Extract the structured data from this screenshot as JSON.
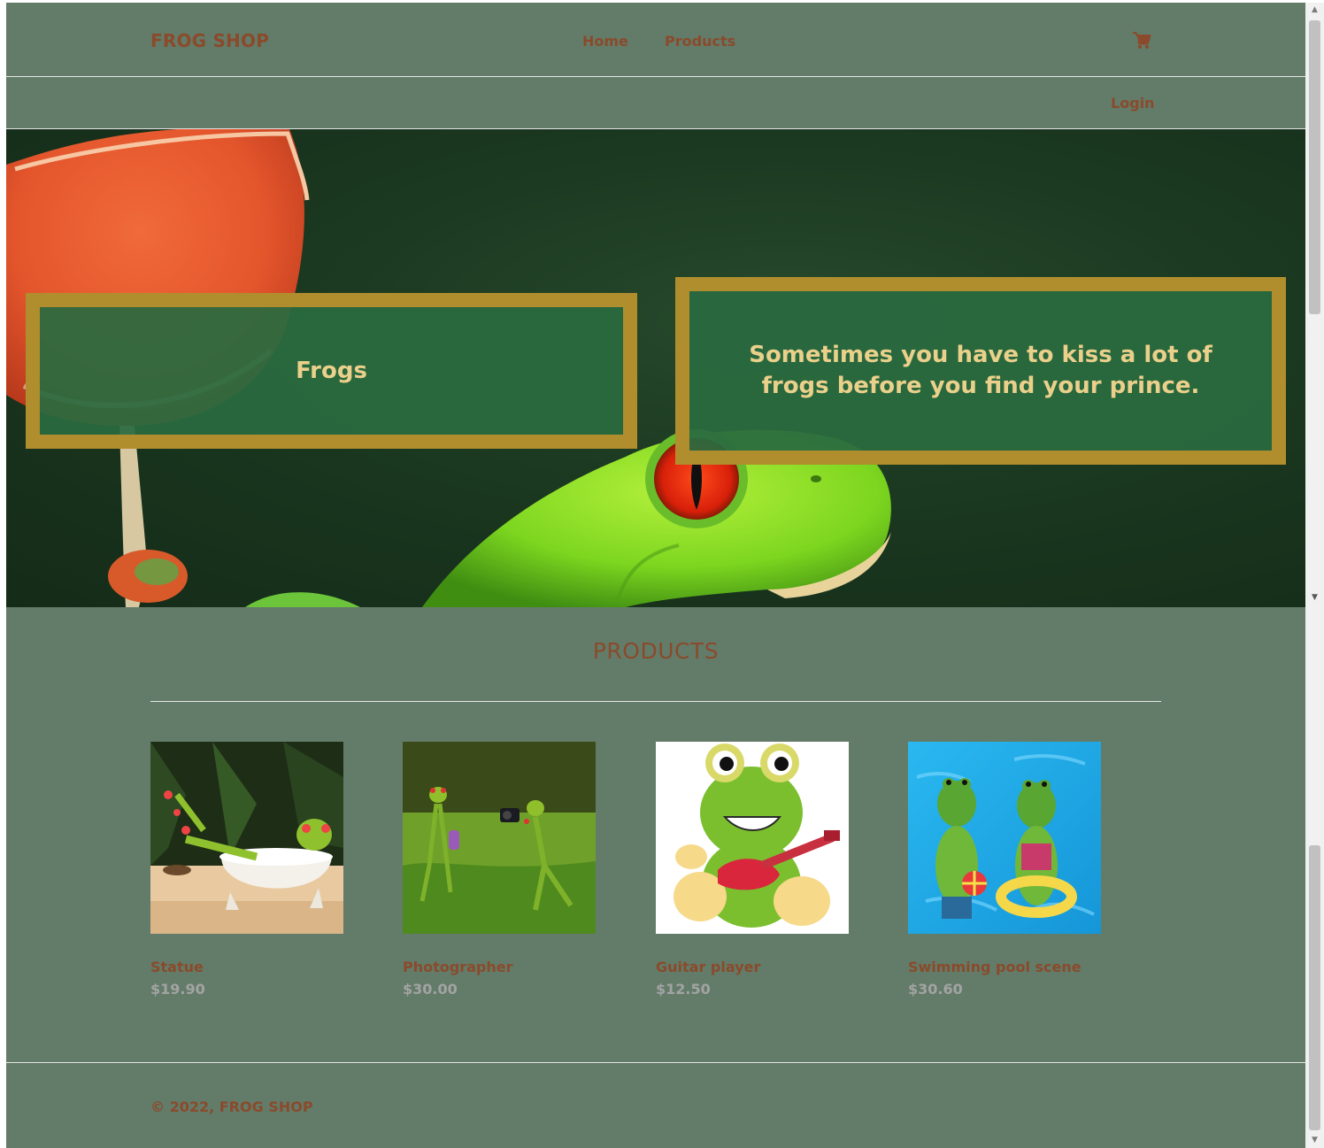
{
  "header": {
    "brand": "FROG SHOP",
    "nav": [
      {
        "label": "Home"
      },
      {
        "label": "Products"
      }
    ],
    "cart_icon": "shopping-cart-icon",
    "login_label": "Login"
  },
  "hero": {
    "title": "Frogs",
    "quote": "Sometimes you have to kiss a lot of frogs before you find your prince."
  },
  "products_section": {
    "heading": "PRODUCTS",
    "items": [
      {
        "name": "Statue",
        "price": "$19.90"
      },
      {
        "name": "Photographer",
        "price": "$30.00"
      },
      {
        "name": "Guitar player",
        "price": "$12.50"
      },
      {
        "name": "Swimming pool scene",
        "price": "$30.60"
      }
    ]
  },
  "footer": {
    "copyright": "© 2022, FROG SHOP"
  },
  "colors": {
    "page_background": "#637c69",
    "brand_text": "#8a4a2b",
    "price_text": "#a3a3a3",
    "hero_box_border": "#b08d2d",
    "hero_box_fill": "#2a6a3f",
    "hero_text": "#ead08a"
  }
}
